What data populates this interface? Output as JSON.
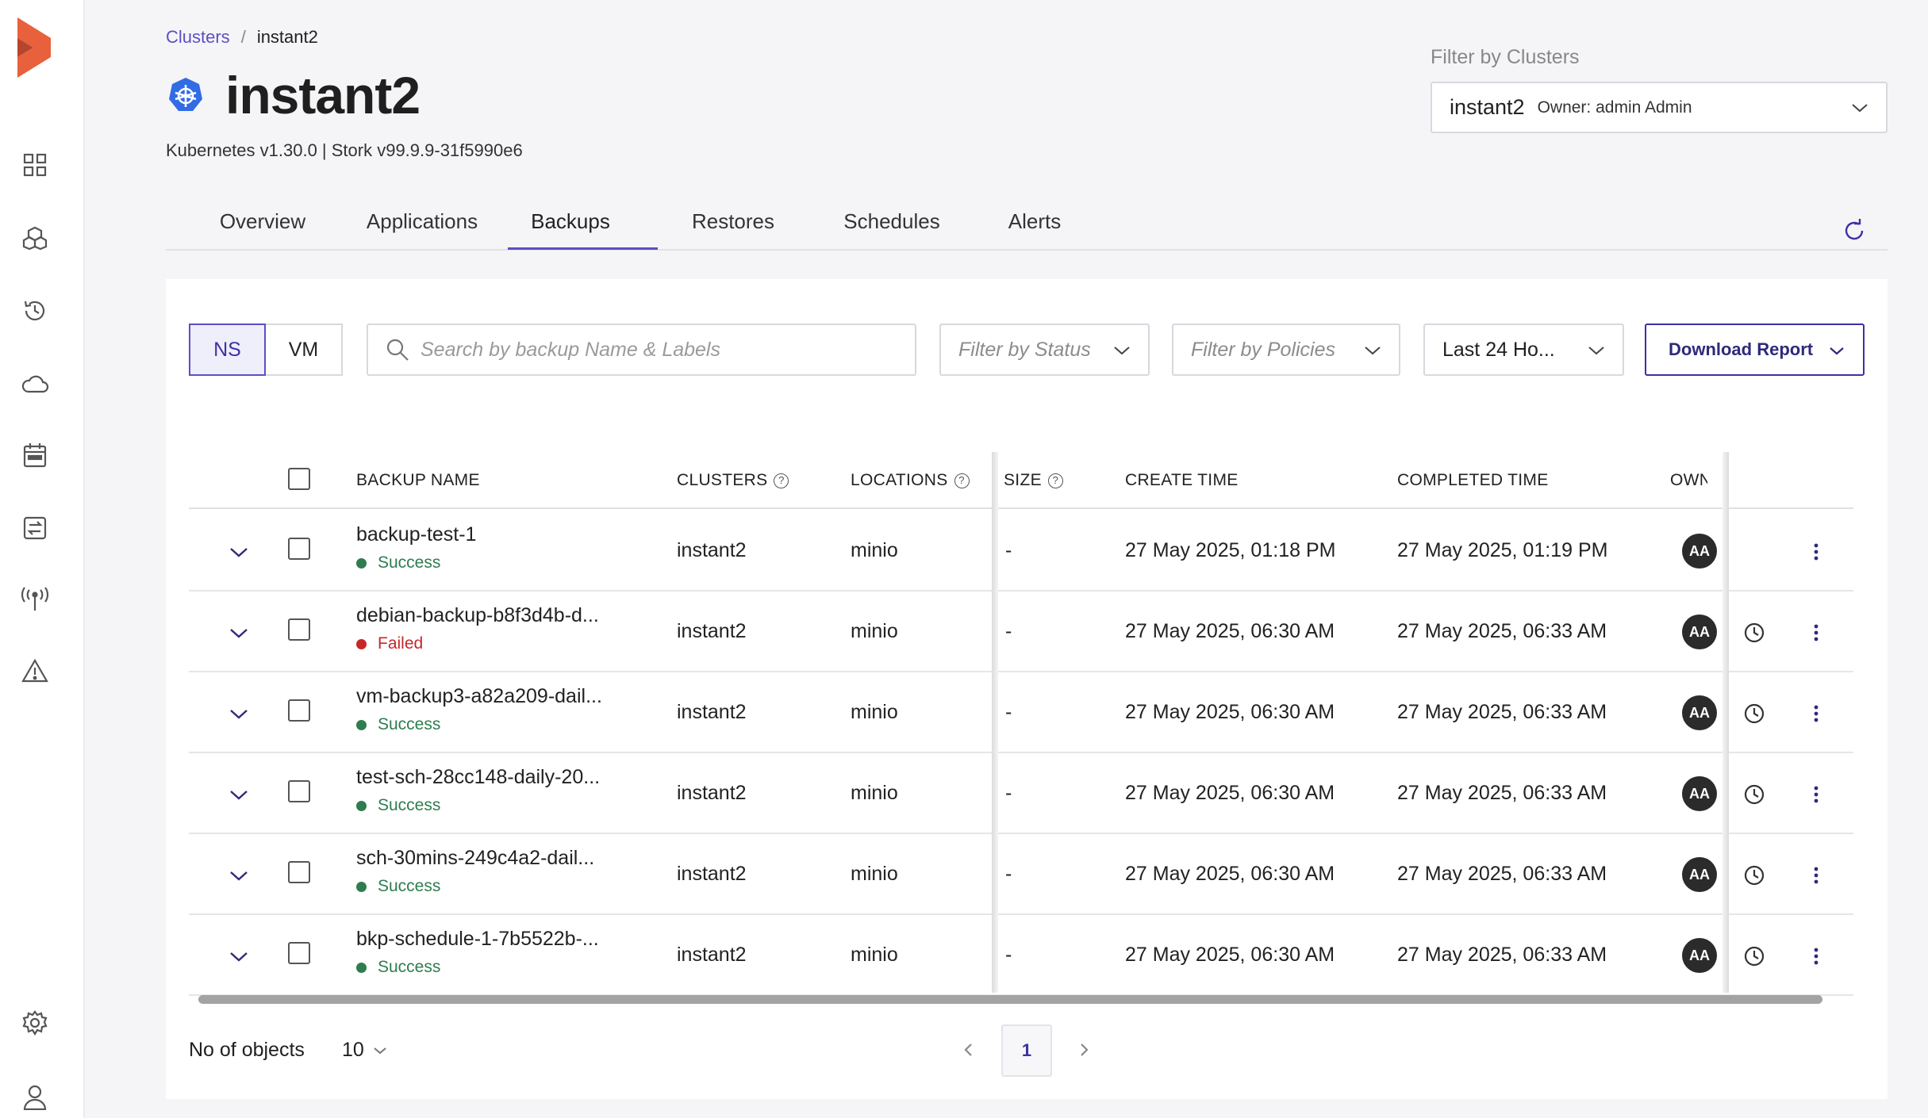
{
  "breadcrumb": {
    "parent": "Clusters",
    "separator": "/",
    "current": "instant2"
  },
  "page": {
    "title": "instant2",
    "subtitle": "Kubernetes v1.30.0 | Stork v99.9.9-31f5990e6"
  },
  "cluster_filter": {
    "label": "Filter by Clusters",
    "selected_name": "instant2",
    "selected_owner": "Owner: admin Admin"
  },
  "tabs": [
    {
      "label": "Overview"
    },
    {
      "label": "Applications"
    },
    {
      "label": "Backups"
    },
    {
      "label": "Restores"
    },
    {
      "label": "Schedules"
    },
    {
      "label": "Alerts"
    }
  ],
  "active_tab": "Backups",
  "toolbar": {
    "seg_ns": "NS",
    "seg_vm": "VM",
    "search_placeholder": "Search by backup Name & Labels",
    "status_filter": "Filter by Status",
    "policies_filter": "Filter by Policies",
    "time_filter": "Last 24 Ho...",
    "download": "Download Report"
  },
  "table": {
    "columns": {
      "name": "BACKUP NAME",
      "clusters": "CLUSTERS",
      "locations": "LOCATIONS",
      "size": "SIZE",
      "create": "CREATE TIME",
      "completed": "COMPLETED TIME",
      "owner": "OWNEF"
    },
    "rows": [
      {
        "name": "backup-test-1",
        "status": "Success",
        "cluster": "instant2",
        "location": "minio",
        "size": "-",
        "create": "27 May 2025, 01:18 PM",
        "completed": "27 May 2025, 01:19 PM",
        "owner": "AA",
        "scheduled": false
      },
      {
        "name": "debian-backup-b8f3d4b-d...",
        "status": "Failed",
        "cluster": "instant2",
        "location": "minio",
        "size": "-",
        "create": "27 May 2025, 06:30 AM",
        "completed": "27 May 2025, 06:33 AM",
        "owner": "AA",
        "scheduled": true
      },
      {
        "name": "vm-backup3-a82a209-dail...",
        "status": "Success",
        "cluster": "instant2",
        "location": "minio",
        "size": "-",
        "create": "27 May 2025, 06:30 AM",
        "completed": "27 May 2025, 06:33 AM",
        "owner": "AA",
        "scheduled": true
      },
      {
        "name": "test-sch-28cc148-daily-20...",
        "status": "Success",
        "cluster": "instant2",
        "location": "minio",
        "size": "-",
        "create": "27 May 2025, 06:30 AM",
        "completed": "27 May 2025, 06:33 AM",
        "owner": "AA",
        "scheduled": true
      },
      {
        "name": "sch-30mins-249c4a2-dail...",
        "status": "Success",
        "cluster": "instant2",
        "location": "minio",
        "size": "-",
        "create": "27 May 2025, 06:30 AM",
        "completed": "27 May 2025, 06:33 AM",
        "owner": "AA",
        "scheduled": true
      },
      {
        "name": "bkp-schedule-1-7b5522b-...",
        "status": "Success",
        "cluster": "instant2",
        "location": "minio",
        "size": "-",
        "create": "27 May 2025, 06:30 AM",
        "completed": "27 May 2025, 06:33 AM",
        "owner": "AA",
        "scheduled": true
      }
    ]
  },
  "pagination": {
    "label": "No of objects",
    "per_page": "10",
    "current_page": "1"
  },
  "colors": {
    "accent": "#5b4fc5",
    "success": "#2e7d4f",
    "failed": "#c62828",
    "brand": "#e8603c"
  },
  "sidebar_icons": [
    "dashboard-icon",
    "applications-icon",
    "history-icon",
    "cloud-icon",
    "calendar-icon",
    "transfer-icon",
    "antenna-icon",
    "alert-icon",
    "gear-icon",
    "user-icon"
  ]
}
